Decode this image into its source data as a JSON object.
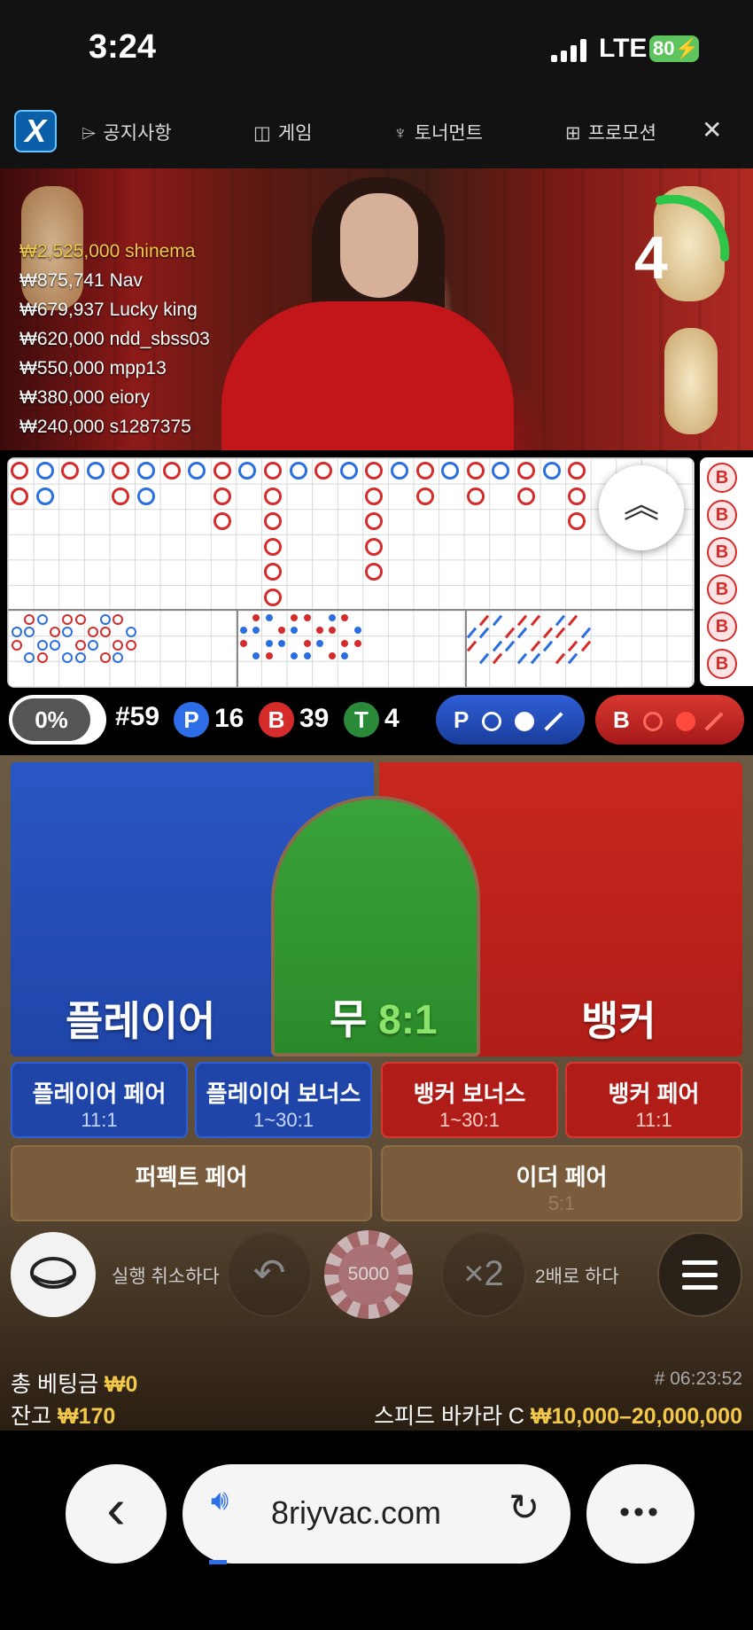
{
  "status": {
    "time": "3:24",
    "network": "LTE",
    "battery": "80"
  },
  "nav": {
    "logo": "X",
    "items": [
      {
        "label": "공지사항",
        "icon": "megaphone-icon",
        "glyph": "⌲"
      },
      {
        "label": "게임",
        "icon": "gamepad-icon",
        "glyph": "◫"
      },
      {
        "label": "토너먼트",
        "icon": "trophy-icon",
        "glyph": "♆"
      },
      {
        "label": "프로모션",
        "icon": "gift-icon",
        "glyph": "⊞"
      }
    ],
    "close": "✕"
  },
  "video": {
    "winners": [
      {
        "amount": "₩2,525,000",
        "name": "shinema"
      },
      {
        "amount": "₩875,741",
        "name": "Nav"
      },
      {
        "amount": "₩679,937",
        "name": "Lucky king"
      },
      {
        "amount": "₩620,000",
        "name": "ndd_sbss03"
      },
      {
        "amount": "₩550,000",
        "name": "mpp13"
      },
      {
        "amount": "₩380,000",
        "name": "eiory"
      },
      {
        "amount": "₩240,000",
        "name": "s1287375"
      }
    ],
    "countdown": "4"
  },
  "road": {
    "up_glyph": "︽",
    "side_label": "B"
  },
  "stats": {
    "percent": "0%",
    "round": "#59",
    "player_letter": "P",
    "player_count": "16",
    "banker_letter": "B",
    "banker_count": "39",
    "tie_letter": "T",
    "tie_count": "4",
    "player_predict": "P",
    "banker_predict": "B"
  },
  "bets": {
    "player": "플레이어",
    "tie": "무",
    "tie_odds": "8:1",
    "banker": "뱅커",
    "player_pair": {
      "label": "플레이어 페어",
      "odds": "11:1"
    },
    "player_bonus": {
      "label": "플레이어 보너스",
      "odds": "1~30:1"
    },
    "banker_bonus": {
      "label": "뱅커 보너스",
      "odds": "1~30:1"
    },
    "banker_pair": {
      "label": "뱅커 페어",
      "odds": "11:1"
    },
    "perfect_pair": {
      "label": "퍼펙트 페어",
      "odds": ""
    },
    "either_pair": {
      "label": "이더 페어",
      "odds": "5:1"
    }
  },
  "controls": {
    "undo_label": "실행 취소하다",
    "chip_value": "5000",
    "double_glyph": "×2",
    "double_label": "2배로 하다"
  },
  "footer": {
    "total_bet_label": "총 베팅금",
    "total_bet_value": "₩0",
    "balance_label": "잔고",
    "balance_value": "₩170",
    "game_id": "# 06:23:52",
    "table_name": "스피드 바카라 C",
    "limits": "₩10,000–20,000,000"
  },
  "browser": {
    "url": "8riyvac.com",
    "back": "‹",
    "more": "•••"
  }
}
